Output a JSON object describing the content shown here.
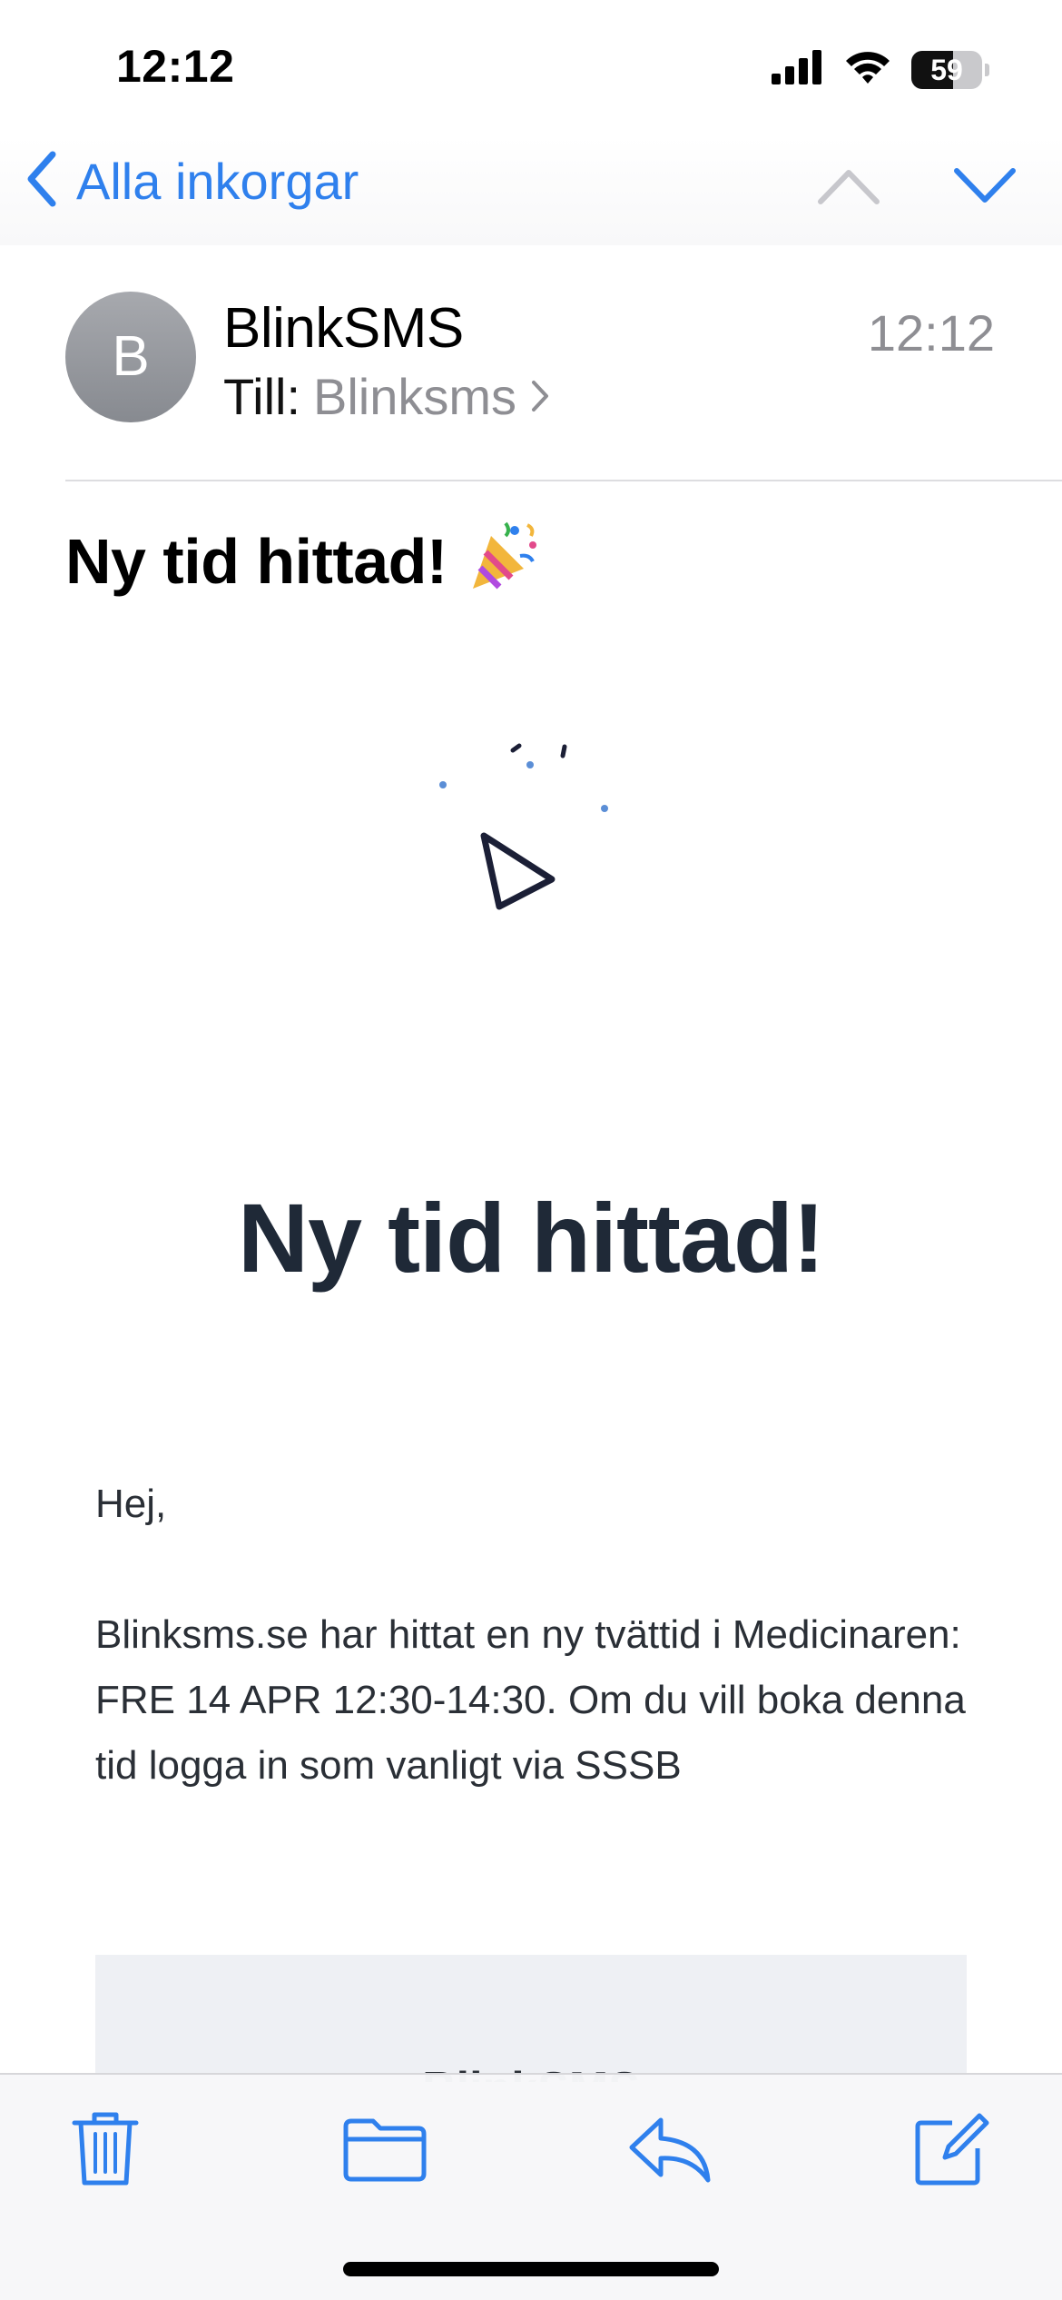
{
  "status_bar": {
    "time": "12:12",
    "battery": "59",
    "battery_level": 0.59
  },
  "nav": {
    "back_label": "Alla inkorgar"
  },
  "message": {
    "avatar_initial": "B",
    "sender": "BlinkSMS",
    "to_label": "Till:",
    "recipient": "Blinksms",
    "time": "12:12",
    "subject": "Ny tid hittad!",
    "subject_emoji": "🎉"
  },
  "email_body": {
    "title": "Ny tid hittad!",
    "greeting": "Hej,",
    "paragraph": "Blinksms.se har hittat en ny tvättid i Medicinaren: FRE 14 APR 12:30-14:30. Om du vill boka denna tid logga in som vanligt via SSSB",
    "footer_brand": "BlinkSMS"
  },
  "colors": {
    "accent": "#2f80ed",
    "secondary_text": "#8e8e93",
    "title_text": "#1f2937"
  },
  "icons": [
    "chevron-left-icon",
    "chevron-up-icon",
    "chevron-down-icon",
    "trash-icon",
    "folder-icon",
    "reply-icon",
    "compose-icon",
    "party-popper-icon",
    "signal-icon",
    "wifi-icon",
    "battery-icon"
  ]
}
